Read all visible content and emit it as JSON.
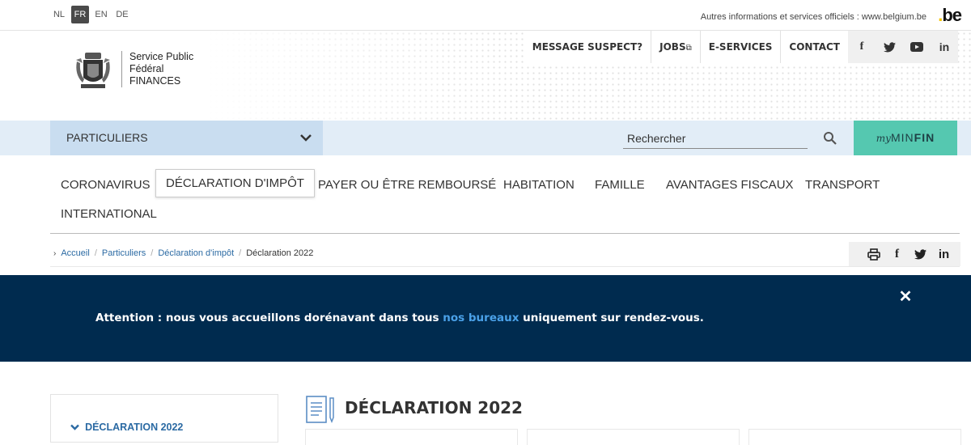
{
  "languages": [
    {
      "code": "NL",
      "active": false
    },
    {
      "code": "FR",
      "active": true
    },
    {
      "code": "EN",
      "active": false
    },
    {
      "code": "DE",
      "active": false
    }
  ],
  "belgium_text": "Autres informations et services officiels : www.belgium.be",
  "be_logo": {
    "dot": ".",
    "text": "be"
  },
  "logo": {
    "line1": "Service Public",
    "line2": "Fédéral",
    "line3": "FINANCES"
  },
  "top_nav": [
    "MESSAGE SUSPECT?",
    "JOBS",
    "E-SERVICES",
    "CONTACT"
  ],
  "social_icons": [
    "facebook-icon",
    "twitter-icon",
    "youtube-icon",
    "linkedin-icon"
  ],
  "audience_dropdown": {
    "label": "PARTICULIERS"
  },
  "search": {
    "placeholder": "Rechercher"
  },
  "myminfin": {
    "my": "my",
    "min": "MIN",
    "fin": "FIN"
  },
  "main_nav": [
    "CORONAVIRUS",
    "DÉCLARATION D'IMPÔT",
    "PAYER OU ÊTRE REMBOURSÉ",
    "HABITATION",
    "FAMILLE",
    "AVANTAGES FISCAUX",
    "TRANSPORT",
    "INTERNATIONAL"
  ],
  "breadcrumb": {
    "items": [
      "Accueil",
      "Particuliers",
      "Déclaration d'impôt"
    ],
    "current": "Déclaration 2022"
  },
  "banner": {
    "before": "Attention : nous vous accueillons dorénavant dans tous ",
    "link": "nos bureaux",
    "after": " uniquement sur rendez-vous."
  },
  "sidebar": {
    "item": "DÉCLARATION 2022"
  },
  "page_title": "DÉCLARATION 2022",
  "colors": {
    "banner": "#002b4f",
    "link": "#2b6aa3",
    "myminfin": "#55c8b0",
    "bluebar": "#e2edf7"
  }
}
